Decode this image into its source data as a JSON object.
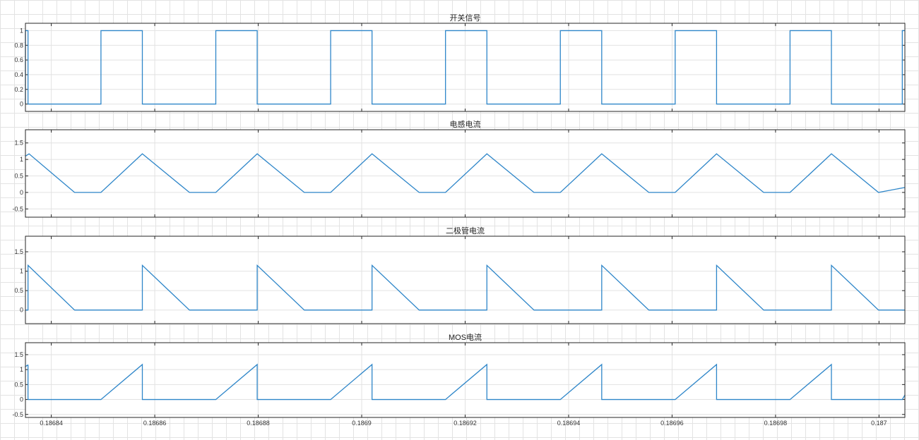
{
  "chart_data": {
    "x": {
      "ticks": [
        0.18684,
        0.18686,
        0.18688,
        0.1869,
        0.18692,
        0.18694,
        0.18696,
        0.18698,
        0.187
      ],
      "tick_labels": [
        "0.18684",
        "0.18686",
        "0.18688",
        "0.1869",
        "0.18692",
        "0.18694",
        "0.18696",
        "0.18698",
        "0.187"
      ],
      "xlim": [
        0.186835,
        0.187005
      ]
    },
    "grid": true,
    "line_color": "#2e86c9",
    "plots": [
      {
        "id": "switch",
        "title": "开关信号",
        "type": "line",
        "ylim": [
          -0.1,
          1.1
        ],
        "yticks": [
          0,
          0.2,
          0.4,
          0.6,
          0.8,
          1
        ],
        "ytick_labels": [
          "0",
          "0.2",
          "0.4",
          "0.6",
          "0.8",
          "1"
        ],
        "series": [
          {
            "x": [
              0.186835,
              0.186835,
              0.1868355,
              0.1868355,
              0.1868496,
              0.1868496,
              0.1868576,
              0.1868576,
              0.1868718,
              0.1868718,
              0.1868798,
              0.1868798,
              0.186894,
              0.186894,
              0.186902,
              0.186902,
              0.1869162,
              0.1869162,
              0.1869242,
              0.1869242,
              0.1869384,
              0.1869384,
              0.1869464,
              0.1869464,
              0.1869606,
              0.1869606,
              0.1869686,
              0.1869686,
              0.1869828,
              0.1869828,
              0.1869908,
              0.1869908,
              0.1870045,
              0.1870045,
              0.187005
            ],
            "y": [
              0,
              1,
              1,
              0,
              0,
              1,
              1,
              0,
              0,
              1,
              1,
              0,
              0,
              1,
              1,
              0,
              0,
              1,
              1,
              0,
              0,
              1,
              1,
              0,
              0,
              1,
              1,
              0,
              0,
              1,
              1,
              0,
              0,
              1,
              1
            ]
          }
        ]
      },
      {
        "id": "inductor",
        "title": "电感电流",
        "type": "line",
        "ylim": [
          -0.75,
          1.9
        ],
        "yticks": [
          -0.5,
          0,
          0.5,
          1,
          1.5
        ],
        "ytick_labels": [
          "-0.5",
          "0",
          "0.5",
          "1",
          "1.5"
        ],
        "series": [
          {
            "x": [
              0.186835,
              0.1868357,
              0.1868445,
              0.1868496,
              0.1868576,
              0.1868667,
              0.1868718,
              0.1868798,
              0.1868889,
              0.186894,
              0.186902,
              0.1869111,
              0.1869162,
              0.1869242,
              0.1869333,
              0.1869384,
              0.1869464,
              0.1869555,
              0.1869606,
              0.1869686,
              0.1869777,
              0.1869828,
              0.1869908,
              0.1869999,
              0.187005
            ],
            "y": [
              1.1,
              1.17,
              0,
              0,
              1.17,
              0,
              0,
              1.17,
              0,
              0,
              1.17,
              0,
              0,
              1.17,
              0,
              0,
              1.17,
              0,
              0,
              1.17,
              0,
              0,
              1.17,
              0,
              0.15
            ]
          }
        ]
      },
      {
        "id": "diode",
        "title": "二极管电流",
        "type": "line",
        "ylim": [
          -0.35,
          1.9
        ],
        "yticks": [
          0,
          0.5,
          1,
          1.5
        ],
        "ytick_labels": [
          "0",
          "0.5",
          "1",
          "1.5"
        ],
        "series": [
          {
            "x": [
              0.186835,
              0.1868355,
              0.1868355,
              0.1868445,
              0.1868576,
              0.1868576,
              0.1868667,
              0.1868798,
              0.1868798,
              0.1868889,
              0.186902,
              0.186902,
              0.1869111,
              0.1869242,
              0.1869242,
              0.1869333,
              0.1869464,
              0.1869464,
              0.1869555,
              0.1869686,
              0.1869686,
              0.1869777,
              0.1869908,
              0.1869908,
              0.1869999,
              0.187005
            ],
            "y": [
              0,
              0,
              1.15,
              0,
              0,
              1.15,
              0,
              0,
              1.15,
              0,
              0,
              1.15,
              0,
              0,
              1.15,
              0,
              0,
              1.15,
              0,
              0,
              1.15,
              0,
              0,
              1.15,
              0,
              0
            ]
          }
        ]
      },
      {
        "id": "mos",
        "title": "MOS电流",
        "type": "line",
        "ylim": [
          -0.6,
          1.9
        ],
        "yticks": [
          -0.5,
          0,
          0.5,
          1,
          1.5
        ],
        "ytick_labels": [
          "-0.5",
          "0",
          "0.5",
          "1",
          "1.5"
        ],
        "series": [
          {
            "x": [
              0.186835,
              0.1868354,
              0.1868355,
              0.1868355,
              0.1868496,
              0.1868576,
              0.1868576,
              0.1868718,
              0.1868798,
              0.1868798,
              0.186894,
              0.186902,
              0.186902,
              0.1869162,
              0.1869242,
              0.1869242,
              0.1869384,
              0.1869464,
              0.1869464,
              0.1869606,
              0.1869686,
              0.1869686,
              0.1869828,
              0.1869908,
              0.1869908,
              0.1870045,
              0.187005
            ],
            "y": [
              1.1,
              1.15,
              1.15,
              0,
              0,
              1.17,
              0,
              0,
              1.17,
              0,
              0,
              1.17,
              0,
              0,
              1.17,
              0,
              0,
              1.17,
              0,
              0,
              1.17,
              0,
              0,
              1.17,
              0,
              0,
              0.15
            ]
          }
        ]
      }
    ]
  }
}
